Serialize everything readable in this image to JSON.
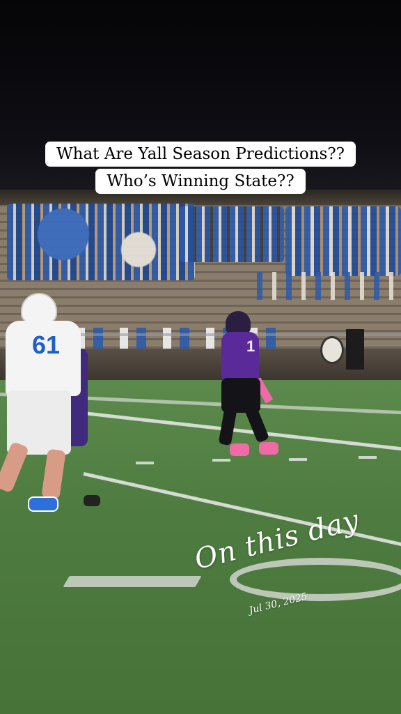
{
  "caption": {
    "line1": "What Are Yall Season Predictions??",
    "line2": "Who’s Winning State??"
  },
  "sticker": {
    "title": "On this day",
    "date": "Jul 30, 2025"
  },
  "players": {
    "lineman_number": "61",
    "quarterback_number": "1"
  },
  "colors": {
    "home_jersey": "#5b2a9a",
    "away_jersey": "#f4f4f4",
    "away_numbers": "#1f5fc8",
    "quarterback_accent": "#f06aa8",
    "field": "#4e7c40",
    "crowd": "#2d5aa8"
  }
}
